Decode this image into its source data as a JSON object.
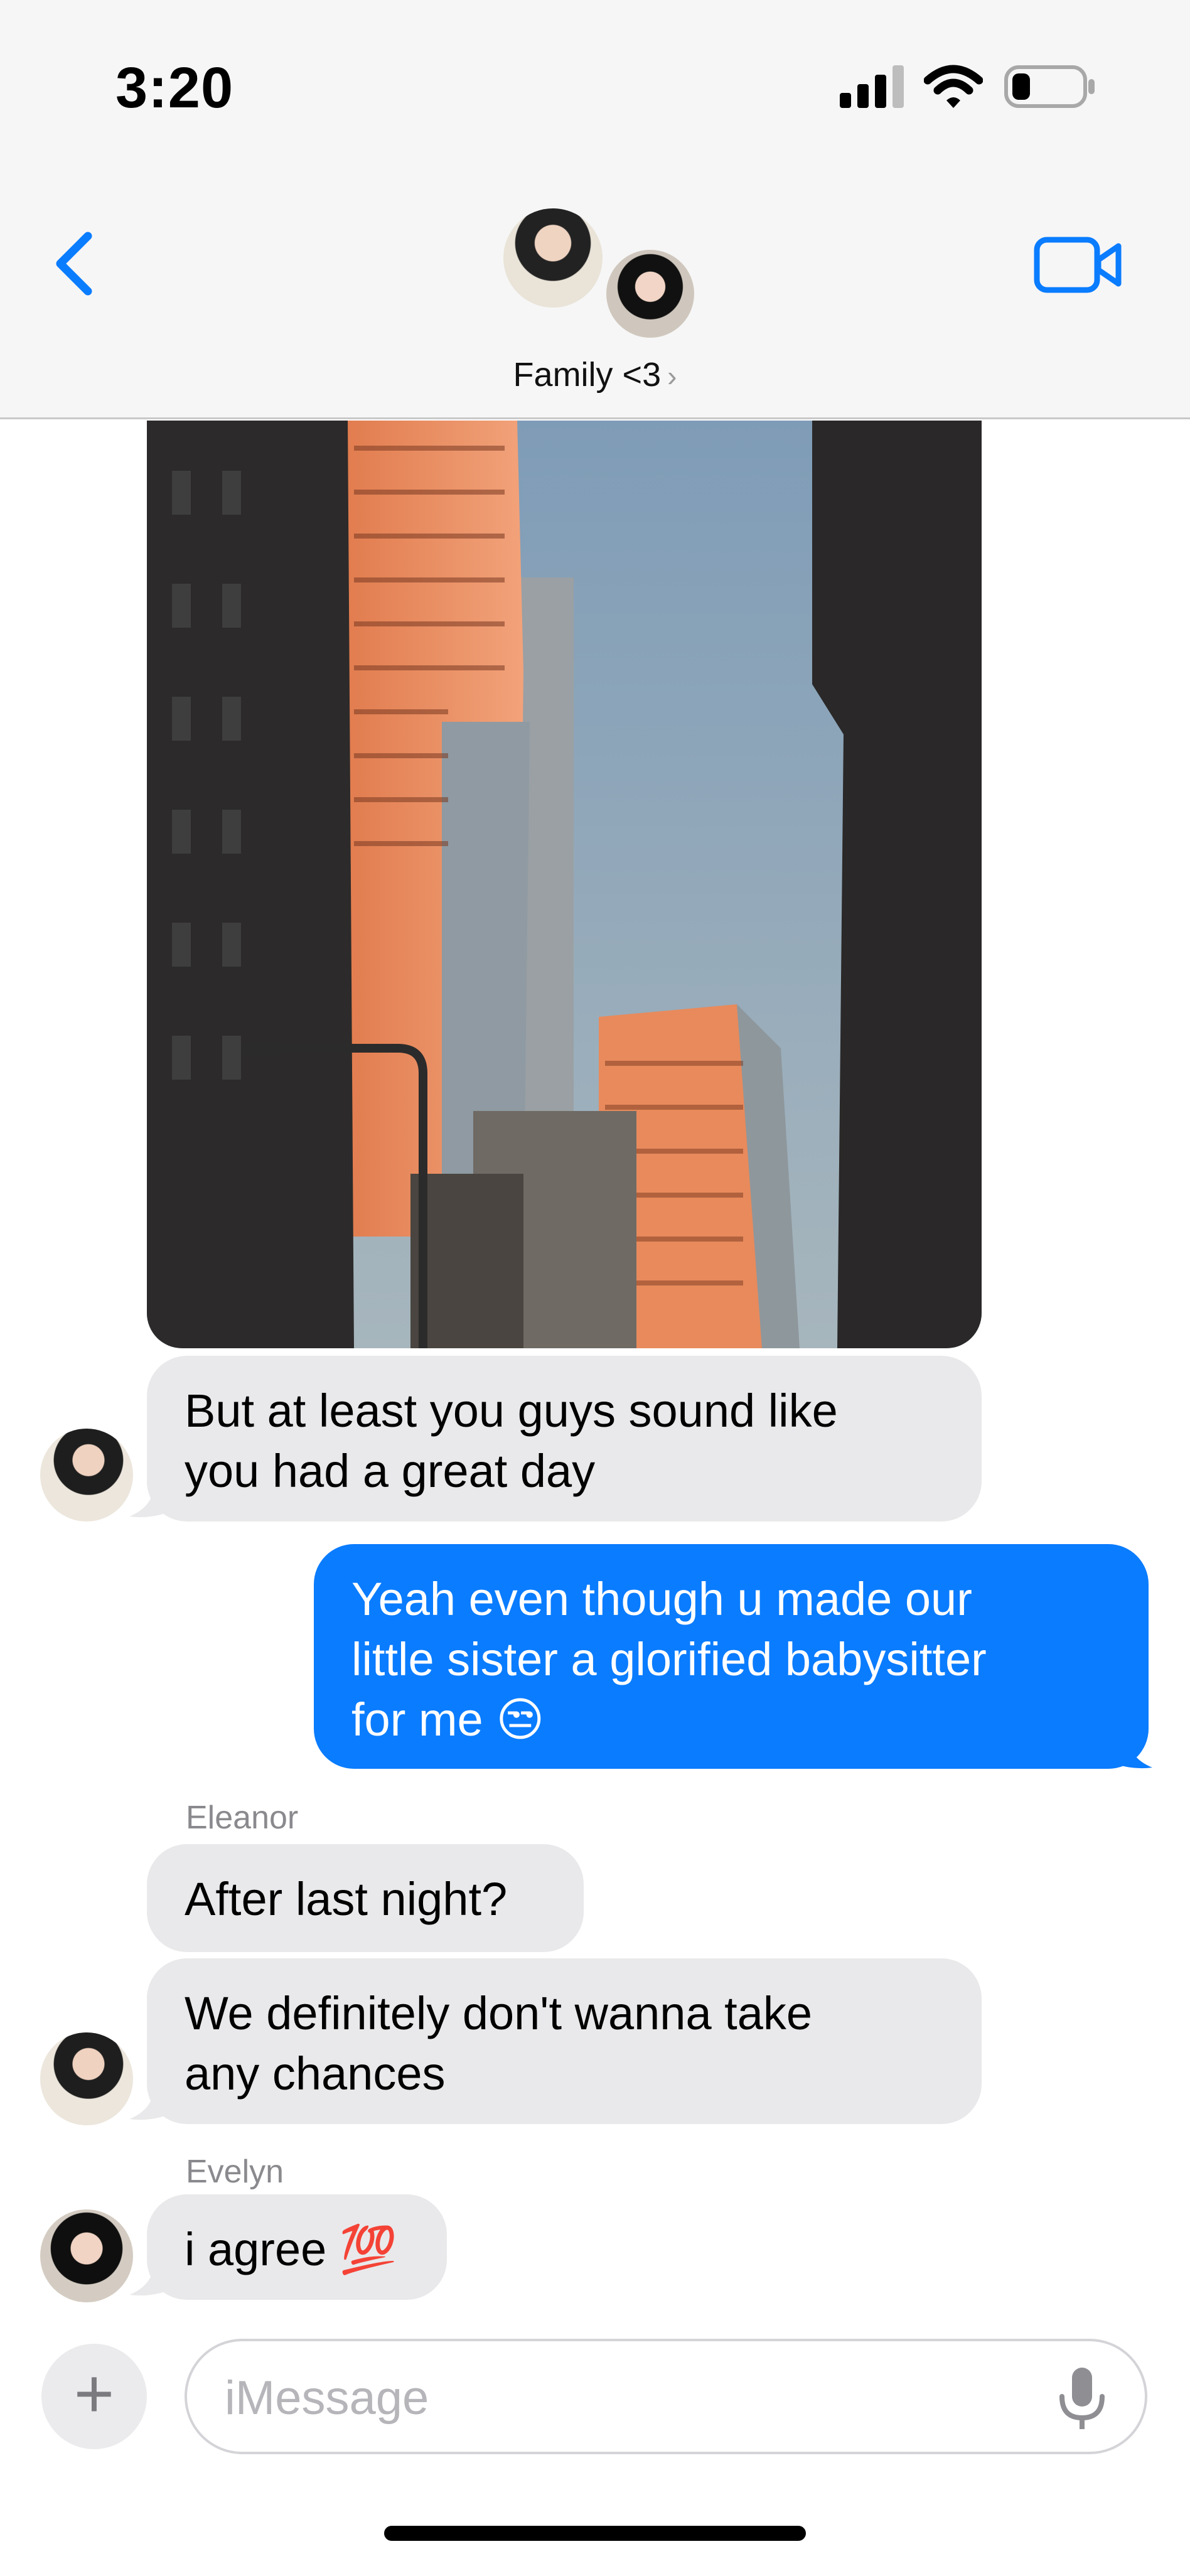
{
  "status_bar": {
    "time": "3:20"
  },
  "header": {
    "group_name": "Family <3",
    "chevron": "›"
  },
  "icons": {
    "back": "chevron-left-icon",
    "video": "video-camera-icon",
    "signal": "cellular-signal-icon",
    "wifi": "wifi-icon",
    "battery": "battery-low-icon",
    "add": "plus-icon",
    "mic": "microphone-icon"
  },
  "colors": {
    "accent": "#0a7cff",
    "incoming_bubble": "#e9e9eb",
    "outgoing_text": "#ffffff"
  },
  "messages": [
    {
      "id": "m1",
      "direction": "in",
      "sender": "",
      "lines": [
        "But at least you guys sound like",
        "you had a great day"
      ]
    },
    {
      "id": "m2",
      "direction": "out",
      "lines": [
        "Yeah even though u made our",
        "little sister a glorified babysitter",
        "for me 😒"
      ]
    },
    {
      "id": "m3",
      "direction": "in",
      "sender": "Eleanor",
      "lines": [
        "After last night?"
      ]
    },
    {
      "id": "m4",
      "direction": "in",
      "sender": "",
      "lines": [
        "We definitely don't wanna take",
        "any chances"
      ]
    },
    {
      "id": "m5",
      "direction": "in",
      "sender": "Evelyn",
      "lines": [
        "i agree 💯"
      ]
    }
  ],
  "composer": {
    "add_label": "+",
    "placeholder": "iMessage"
  }
}
